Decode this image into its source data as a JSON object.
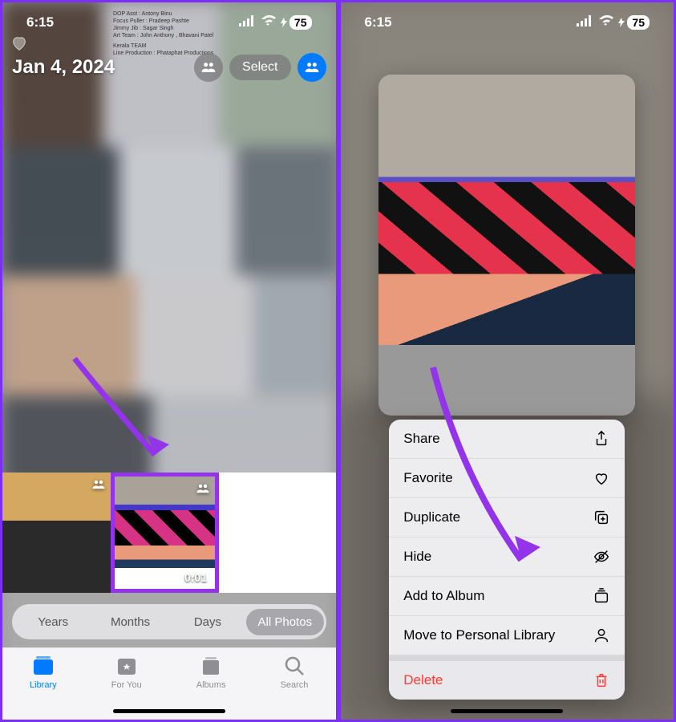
{
  "status": {
    "time": "6:15",
    "battery": "75"
  },
  "left": {
    "date_title": "Jan 4, 2024",
    "select_label": "Select",
    "thumb_duration": "0:01",
    "view_tabs": [
      "Years",
      "Months",
      "Days",
      "All Photos"
    ],
    "tabs": [
      "Library",
      "For You",
      "Albums",
      "Search"
    ]
  },
  "right": {
    "menu": {
      "share": "Share",
      "favorite": "Favorite",
      "duplicate": "Duplicate",
      "hide": "Hide",
      "add_to_album": "Add to Album",
      "move_personal": "Move to Personal Library",
      "delete": "Delete"
    }
  },
  "credits": {
    "l1": "DOP Asst : Antony Binu",
    "l2": "Focus Puller : Pradeep Pashte",
    "l3": "Jimmy Jib : Sagar Singh",
    "l4": "Art Team : John Anthony , Bhavani Patel",
    "l5": "Kerala TEAM",
    "l6": "Line Production : Phataphat Productions"
  }
}
